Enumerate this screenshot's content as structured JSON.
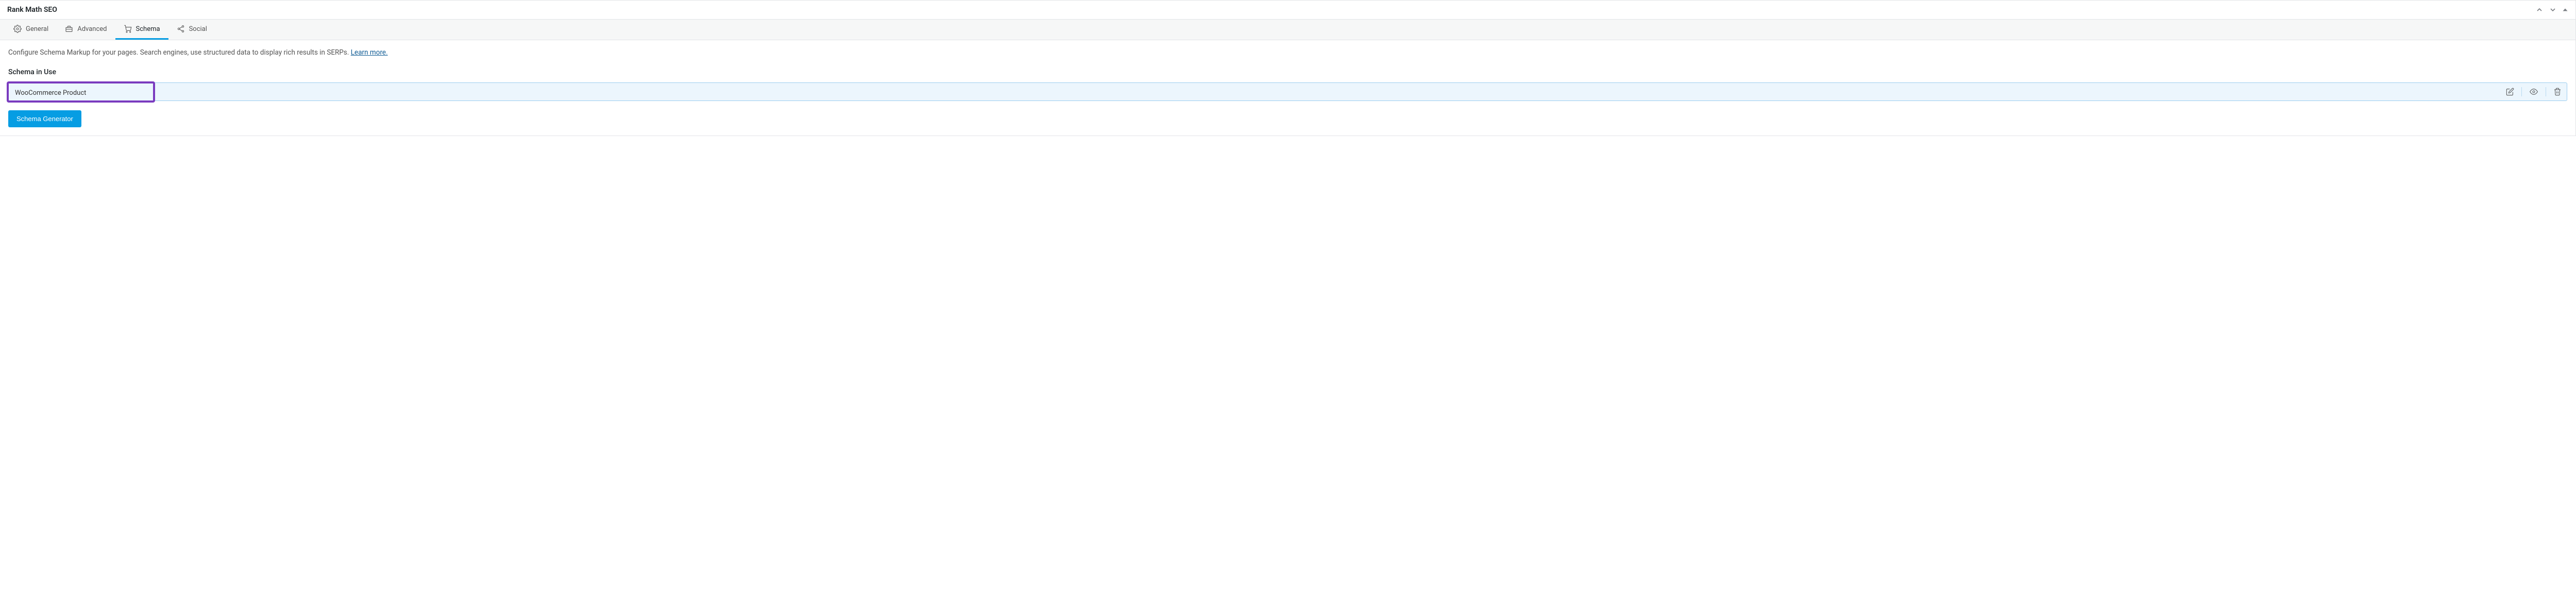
{
  "panel": {
    "title": "Rank Math SEO"
  },
  "tabs": {
    "general": "General",
    "advanced": "Advanced",
    "schema": "Schema",
    "social": "Social"
  },
  "content": {
    "description_prefix": "Configure Schema Markup for your pages. Search engines, use structured data to display rich results in SERPs. ",
    "learn_more": "Learn more.",
    "section_label": "Schema in Use",
    "schema_item": "WooCommerce Product",
    "generator_button": "Schema Generator"
  }
}
